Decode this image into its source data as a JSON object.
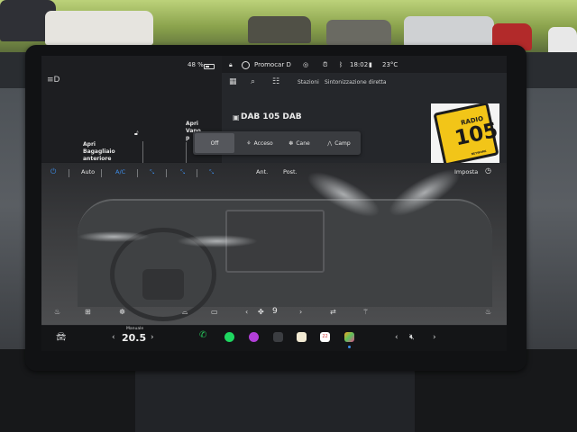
{
  "status_bar": {
    "battery_percent": "48 %",
    "profile_name": "Promocar D",
    "time": "18:02",
    "outside_temp": "23°C"
  },
  "lights_panel": {
    "trunk_line1": "Apri",
    "trunk_line2": "Bagagliaio",
    "trunk_line3": "anteriore",
    "frunk_line1": "Apri",
    "frunk_line2": "Vano",
    "frunk_line3": "p"
  },
  "media": {
    "tabs": [
      "Stazioni",
      "Sintonizzazione diretta"
    ],
    "station_name": "DAB 105 DAB",
    "art_top": "RADIO",
    "art_number": "105",
    "art_bottom": "NETWORK"
  },
  "modes": {
    "off": "Off",
    "on": "Acceso",
    "dog": "Cane",
    "camp": "Camp"
  },
  "climate": {
    "auto": "Auto",
    "ac": "A/C",
    "front": "Ant.",
    "rear": "Post.",
    "settings": "Imposta",
    "fan_speed": "9",
    "accent_color": "#3d8dea"
  },
  "dock": {
    "temp_label": "Manuale",
    "temp_value": "20.5",
    "calendar_day": "22"
  }
}
